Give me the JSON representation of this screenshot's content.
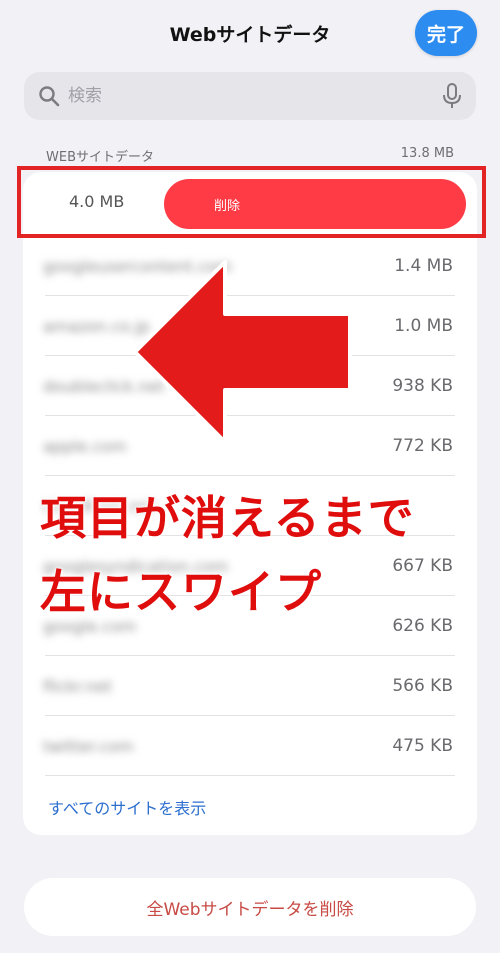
{
  "nav": {
    "title": "Webサイトデータ",
    "done_label": "完了"
  },
  "search": {
    "placeholder": "検索"
  },
  "section": {
    "label": "WEBサイトデータ",
    "total": "13.8 MB"
  },
  "swipe_row": {
    "size": "4.0 MB",
    "delete_label": "削除"
  },
  "rows": [
    {
      "name": "googleusercontent.com",
      "size": "1.4 MB"
    },
    {
      "name": "amazon.co.jp",
      "size": "1.0 MB"
    },
    {
      "name": "doubleclick.net",
      "size": "938 KB"
    },
    {
      "name": "apple.com",
      "size": "772 KB"
    },
    {
      "name": "cloudfront.net",
      "size": ""
    },
    {
      "name": "googlesyndication.com",
      "size": "667 KB"
    },
    {
      "name": "google.com",
      "size": "626 KB"
    },
    {
      "name": "flickr.net",
      "size": "566 KB"
    },
    {
      "name": "twitter.com",
      "size": "475 KB"
    }
  ],
  "show_all_label": "すべてのサイトを表示",
  "delete_all_label": "全Webサイトデータを削除",
  "annotation": {
    "line1": "項目が消えるまで",
    "line2": "左にスワイプ"
  },
  "colors": {
    "accent": "#2c8cf0",
    "delete": "#ff3b45",
    "annotation": "#e00d0d"
  }
}
